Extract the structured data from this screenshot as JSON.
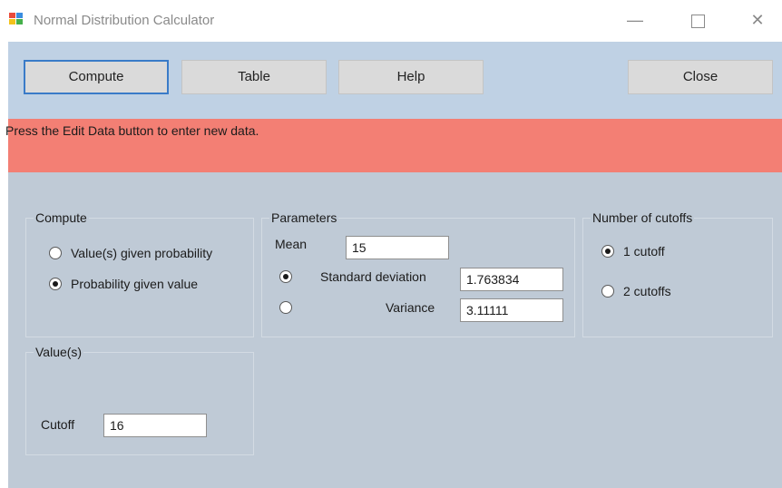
{
  "window": {
    "title": "Normal Distribution Calculator",
    "minimize_glyph": "—",
    "close_glyph": "✕"
  },
  "toolbar": {
    "compute_label": "Compute",
    "table_label": "Table",
    "help_label": "Help",
    "close_label": "Close"
  },
  "banner": {
    "message": "Press the Edit Data button to enter new data.",
    "color": "#f37f74"
  },
  "compute_group": {
    "title": "Compute",
    "options": [
      {
        "label": "Value(s) given probability",
        "checked": false
      },
      {
        "label": "Probability given value",
        "checked": true
      }
    ]
  },
  "parameters_group": {
    "title": "Parameters",
    "mean_label": "Mean",
    "mean_value": "15",
    "sd_label": "Standard deviation",
    "sd_value": "1.763834",
    "sd_selected": true,
    "variance_label": "Variance",
    "variance_value": "3.11111",
    "variance_selected": false
  },
  "cutoffs_group": {
    "title": "Number of cutoffs",
    "options": [
      {
        "label": "1 cutoff",
        "checked": true
      },
      {
        "label": "2 cutoffs",
        "checked": false
      }
    ]
  },
  "values_group": {
    "title": "Value(s)",
    "cutoff_label": "Cutoff",
    "cutoff_value": "16"
  }
}
